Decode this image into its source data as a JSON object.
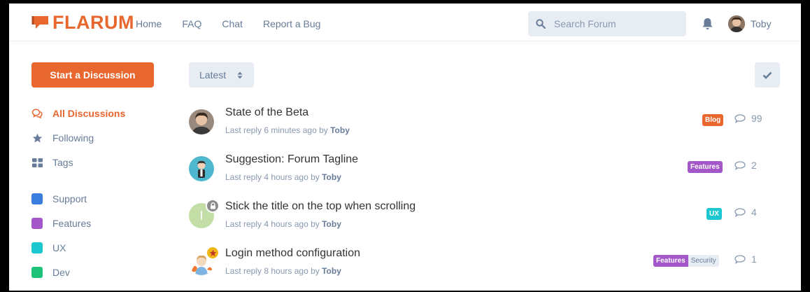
{
  "header": {
    "logo_text": "FLARUM",
    "nav": [
      "Home",
      "FAQ",
      "Chat",
      "Report a Bug"
    ],
    "search_placeholder": "Search Forum",
    "user_name": "Toby"
  },
  "sidebar": {
    "start_label": "Start a Discussion",
    "items": [
      {
        "label": "All Discussions",
        "icon": "comments-icon"
      },
      {
        "label": "Following",
        "icon": "star-icon"
      },
      {
        "label": "Tags",
        "icon": "tags-grid-icon"
      }
    ],
    "tags": [
      {
        "label": "Support",
        "color": "#3b7ddd"
      },
      {
        "label": "Features",
        "color": "#a357c9"
      },
      {
        "label": "UX",
        "color": "#1dc7cf"
      },
      {
        "label": "Dev",
        "color": "#1ec27a"
      }
    ]
  },
  "toolbar": {
    "sort_label": "Latest"
  },
  "discussions": [
    {
      "title": "State of the Beta",
      "meta_prefix": "Last reply 6 minutes ago by",
      "author": "Toby",
      "tags": [
        {
          "label": "Blog",
          "color": "#e7672e"
        }
      ],
      "replies": "99"
    },
    {
      "title": "Suggestion: Forum Tagline",
      "meta_prefix": "Last reply 4 hours ago by",
      "author": "Toby",
      "tags": [
        {
          "label": "Features",
          "color": "#a357c9"
        }
      ],
      "replies": "2"
    },
    {
      "title": "Stick the title on the top when scrolling",
      "meta_prefix": "Last reply 4 hours ago by",
      "author": "Toby",
      "tags": [
        {
          "label": "UX",
          "color": "#1dc7cf"
        }
      ],
      "replies": "4",
      "avatar_letter": "I"
    },
    {
      "title": "Login method configuration",
      "meta_prefix": "Last reply 8 hours ago by",
      "author": "Toby",
      "tags": [
        {
          "label": "Features",
          "color": "#a357c9"
        },
        {
          "label": "Security",
          "color": "#e8ecf3"
        }
      ],
      "replies": "1"
    }
  ]
}
